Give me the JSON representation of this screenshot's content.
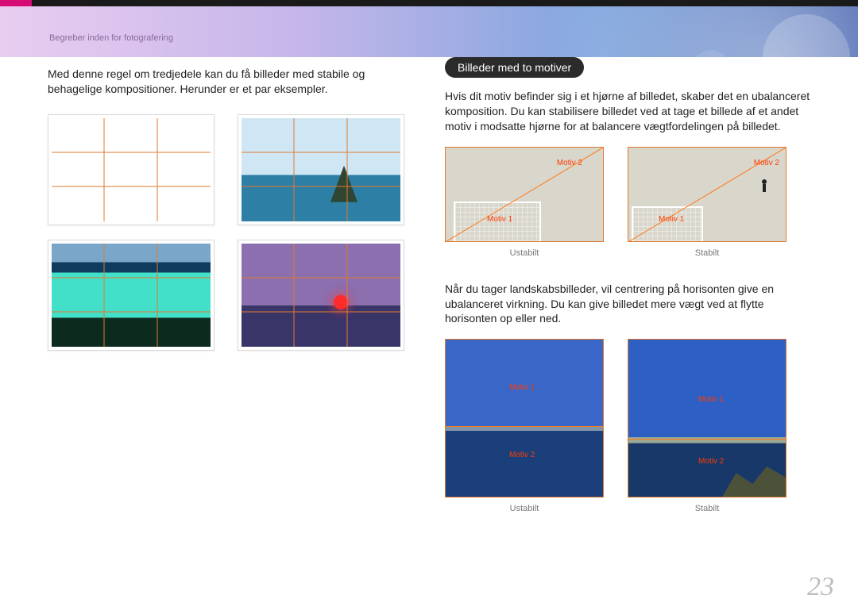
{
  "header": {
    "section_label": "Begreber inden for fotografering"
  },
  "left": {
    "intro": "Med denne regel om tredjedele kan du få billeder med stabile og behagelige kompositioner. Herunder er et par eksempler."
  },
  "right": {
    "heading": "Billeder med to motiver",
    "para1": "Hvis dit motiv befinder sig i et hjørne af billedet, skaber det en ubalanceret komposition. Du kan stabilisere billedet ved at tage et billede af et andet motiv i modsatte hjørne for at balancere vægtfordelingen på billedet.",
    "pair1": {
      "left": {
        "motiv1": "Motiv 1",
        "motiv2": "Motiv 2",
        "caption": "Ustabilt"
      },
      "right": {
        "motiv1": "Motiv 1",
        "motiv2": "Motiv 2",
        "caption": "Stabilt"
      }
    },
    "para2": "Når du tager landskabsbilleder, vil centrering på horisonten give en ubalanceret virkning. Du kan give billedet mere vægt ved at flytte horisonten op eller ned.",
    "pair2": {
      "left": {
        "motiv1": "Motiv 1",
        "motiv2": "Motiv 2",
        "caption": "Ustabilt"
      },
      "right": {
        "motiv1": "Motiv 1",
        "motiv2": "Motiv 2",
        "caption": "Stabilt"
      }
    }
  },
  "page_number": "23"
}
